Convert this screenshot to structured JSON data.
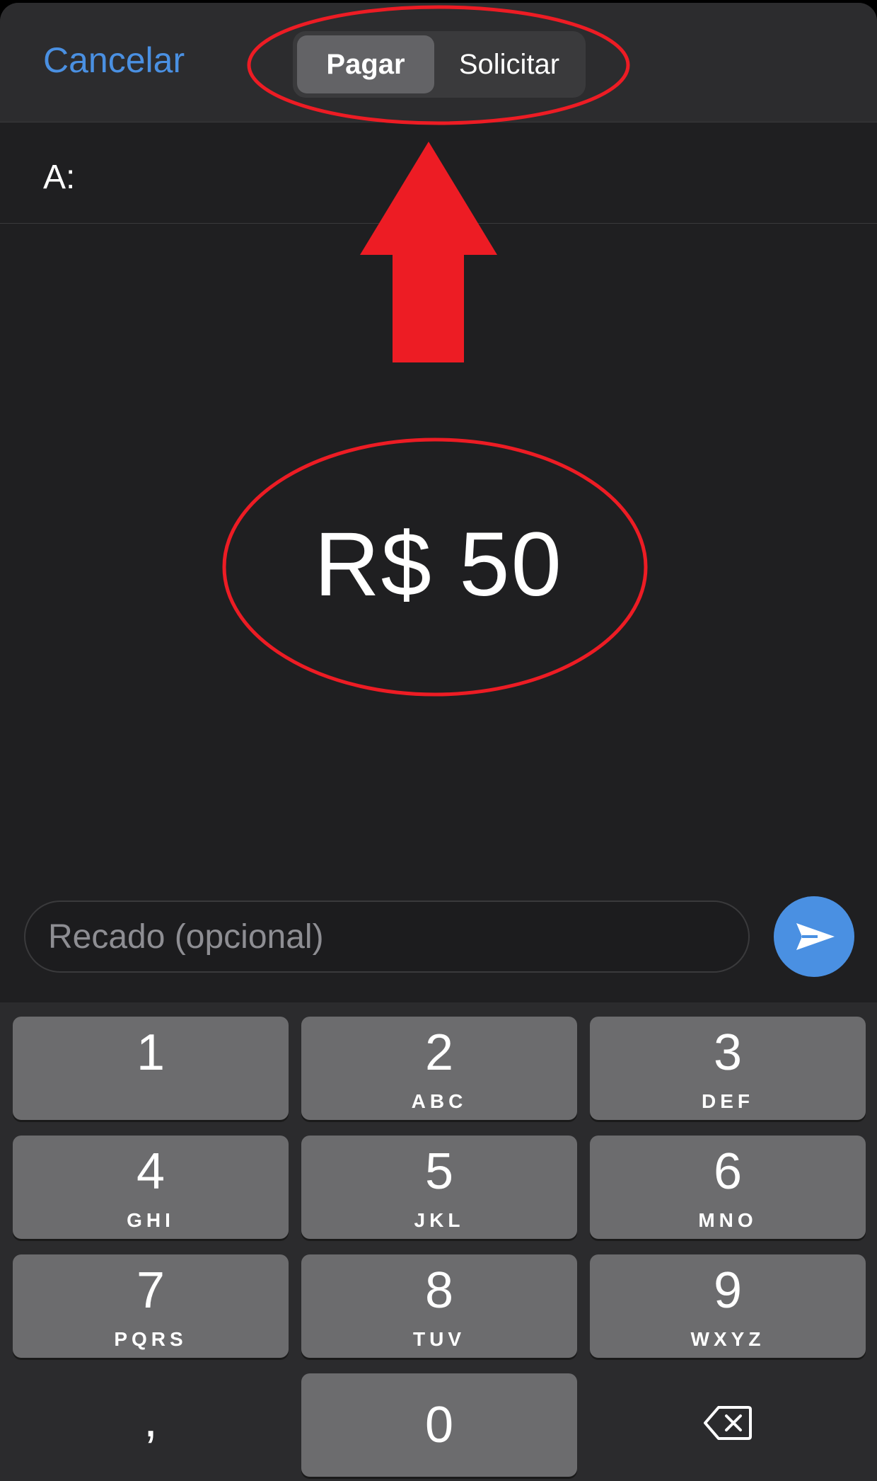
{
  "header": {
    "cancel_label": "Cancelar",
    "segments": [
      {
        "label": "Pagar",
        "selected": true
      },
      {
        "label": "Solicitar",
        "selected": false
      }
    ]
  },
  "recipient": {
    "label": "A:"
  },
  "amount": {
    "display": "R$ 50"
  },
  "message": {
    "placeholder": "Recado (opcional)"
  },
  "send_icon": "paper-plane-icon",
  "keypad": [
    {
      "digit": "1",
      "letters": ""
    },
    {
      "digit": "2",
      "letters": "ABC"
    },
    {
      "digit": "3",
      "letters": "DEF"
    },
    {
      "digit": "4",
      "letters": "GHI"
    },
    {
      "digit": "5",
      "letters": "JKL"
    },
    {
      "digit": "6",
      "letters": "MNO"
    },
    {
      "digit": "7",
      "letters": "PQRS"
    },
    {
      "digit": "8",
      "letters": "TUV"
    },
    {
      "digit": "9",
      "letters": "WXYZ"
    },
    {
      "digit": ",",
      "letters": ""
    },
    {
      "digit": "0",
      "letters": ""
    }
  ],
  "delete_icon": "backspace-icon",
  "colors": {
    "accent": "#4a90e2",
    "background": "#1f1f21",
    "annotation": "#ed1c24"
  }
}
